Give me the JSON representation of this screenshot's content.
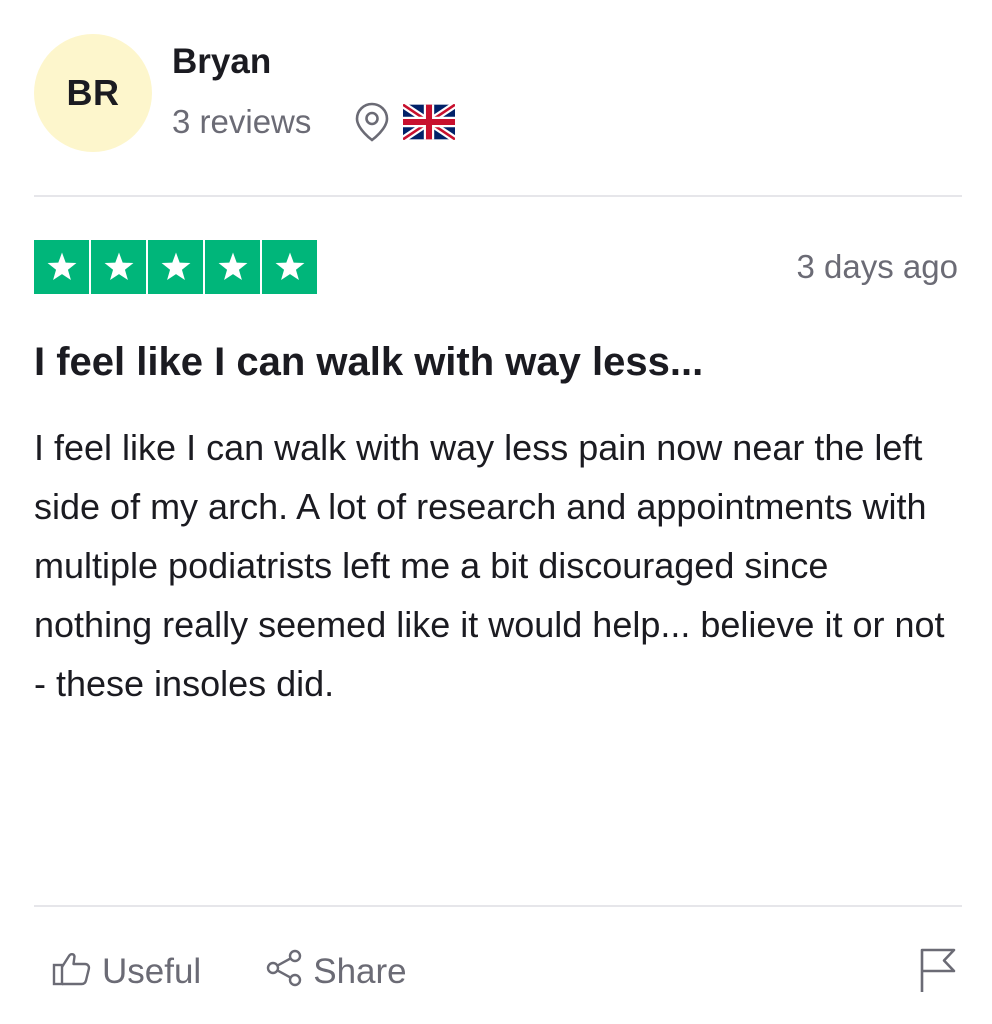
{
  "reviewer": {
    "initials": "BR",
    "name": "Bryan",
    "review_count": "3 reviews",
    "avatar_color": "#fdf6cc",
    "location_icon": "location-pin-icon",
    "country_flag_icon": "uk-flag-icon"
  },
  "review": {
    "rating": 5,
    "max_rating": 5,
    "star_color": "#00b67a",
    "date": "3 days ago",
    "title": "I feel like I can walk with way less...",
    "body": "I feel like I can walk with way less pain now near the left side of my arch. A lot of research and appointments with multiple podiatrists left me a bit discouraged since nothing really seemed like it would help... believe it or not - these insoles did."
  },
  "actions": {
    "useful_label": "Useful",
    "useful_icon": "thumbs-up-icon",
    "share_label": "Share",
    "share_icon": "share-icon",
    "report_icon": "flag-icon"
  }
}
